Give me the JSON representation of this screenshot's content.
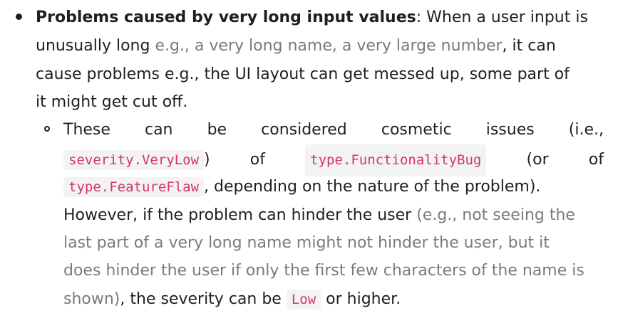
{
  "bullet_main": {
    "heading": "Problems caused by very long input values",
    "colon": ":",
    "line1_rest": " When a user input is",
    "line2_start": "unusually long ",
    "line2_muted": "e.g., a very long name, a very large number",
    "line2_end": ", it can",
    "line3": "cause problems e.g., the UI layout can get messed up, some part of",
    "line4": "it might get cut off."
  },
  "sub_bullet": {
    "row1_words": [
      "These",
      "can",
      "be",
      "considered",
      "cosmetic",
      "issues",
      "(i.e.,"
    ],
    "tag_very_low": "severity.VeryLow",
    "close_paren": ")",
    "of_1": "of",
    "tag_functionality_bug": "type.FunctionalityBug",
    "or_paren": "(or",
    "of_2": "of",
    "tag_feature_flaw": "type.FeatureFlaw",
    "row3_rest": ", depending on the nature of the problem).",
    "row4_start": "However, if the problem can hinder the user ",
    "row4_muted": "(e.g., not seeing the",
    "row5_muted": "last part of a very long name might not hinder the user, but it",
    "row6_muted": "does hinder the user if only the first few characters of the name is",
    "row7_muted": "shown)",
    "row7_text": ", the severity can be ",
    "tag_low": "Low",
    "row7_end": " or higher."
  }
}
